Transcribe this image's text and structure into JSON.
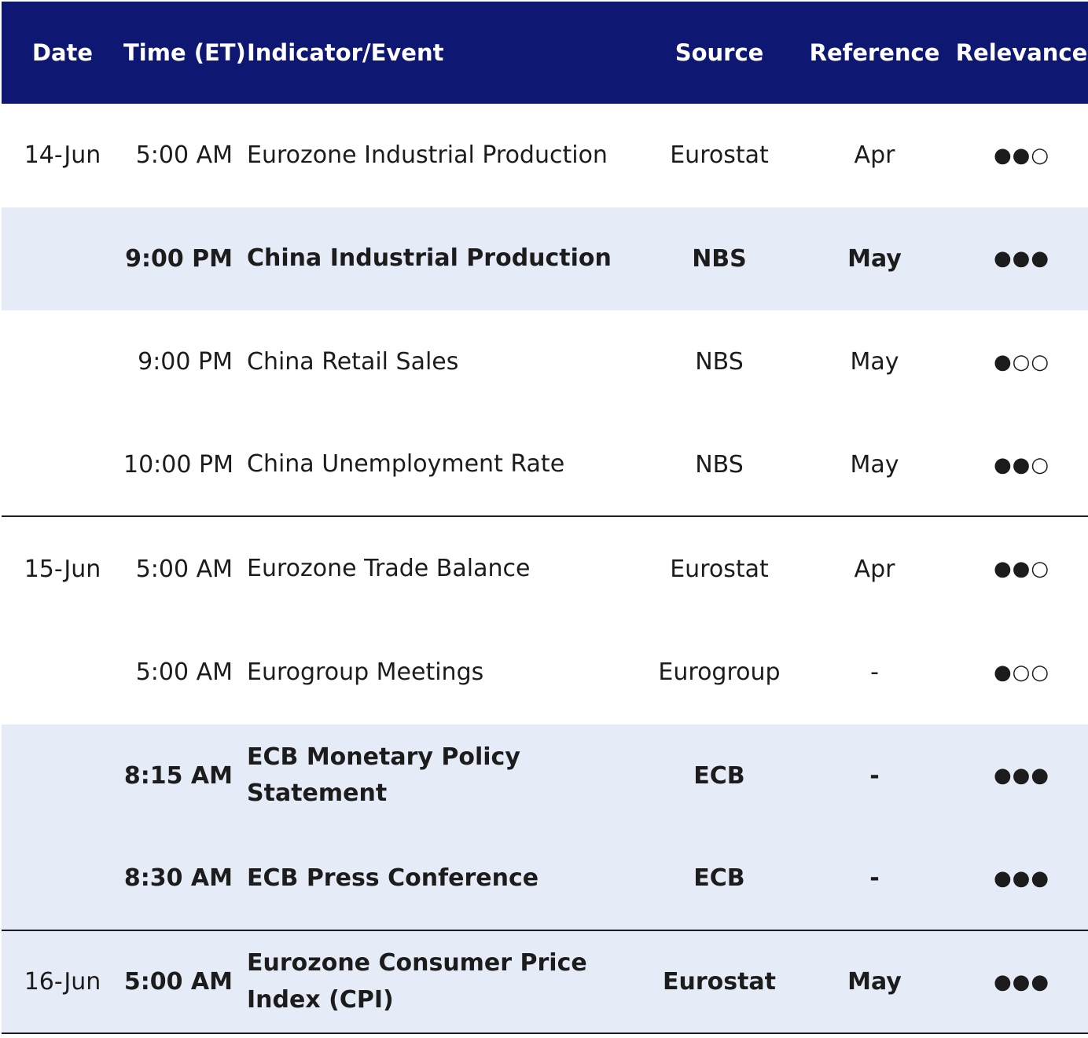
{
  "header": {
    "date": "Date",
    "time": "Time (ET)",
    "event": "Indicator/Event",
    "source": "Source",
    "reference": "Reference",
    "relevance": "Relevance"
  },
  "rows": [
    {
      "date": "14-Jun",
      "time": "5:00 AM",
      "event": "Eurozone Industrial Production",
      "source": "Eurostat",
      "reference": "Apr",
      "relevance": "●●○",
      "relevance_level": 2,
      "bold": false,
      "shaded": false
    },
    {
      "date": "",
      "time": "9:00 PM",
      "event": "China Industrial Production",
      "source": "NBS",
      "reference": "May",
      "relevance": "●●●",
      "relevance_level": 3,
      "bold": true,
      "shaded": true
    },
    {
      "date": "",
      "time": "9:00 PM",
      "event": "China Retail Sales",
      "source": "NBS",
      "reference": "May",
      "relevance": "●○○",
      "relevance_level": 1,
      "bold": false,
      "shaded": false
    },
    {
      "date": "",
      "time": "10:00 PM",
      "event": "China Unemployment Rate",
      "source": "NBS",
      "reference": "May",
      "relevance": "●●○",
      "relevance_level": 2,
      "bold": false,
      "shaded": false
    },
    {
      "date": "15-Jun",
      "time": "5:00 AM",
      "event": "Eurozone Trade Balance",
      "source": "Eurostat",
      "reference": "Apr",
      "relevance": "●●○",
      "relevance_level": 2,
      "bold": false,
      "shaded": false
    },
    {
      "date": "",
      "time": "5:00 AM",
      "event": "Eurogroup Meetings",
      "source": "Eurogroup",
      "reference": "-",
      "relevance": "●○○",
      "relevance_level": 1,
      "bold": false,
      "shaded": false
    },
    {
      "date": "",
      "time": "8:15 AM",
      "event": "ECB Monetary Policy Statement",
      "source": "ECB",
      "reference": "-",
      "relevance": "●●●",
      "relevance_level": 3,
      "bold": true,
      "shaded": true
    },
    {
      "date": "",
      "time": "8:30 AM",
      "event": "ECB Press Conference",
      "source": "ECB",
      "reference": "-",
      "relevance": "●●●",
      "relevance_level": 3,
      "bold": true,
      "shaded": true
    },
    {
      "date": "16-Jun",
      "time": "5:00 AM",
      "event": "Eurozone Consumer Price Index (CPI)",
      "source": "Eurostat",
      "reference": "May",
      "relevance": "●●●",
      "relevance_level": 3,
      "bold": true,
      "shaded": true
    }
  ],
  "colors": {
    "header_bg": "#0e1772",
    "header_text": "#ffffff",
    "shaded_row_bg": "#e6ecf7",
    "text": "#1c1c1c"
  }
}
